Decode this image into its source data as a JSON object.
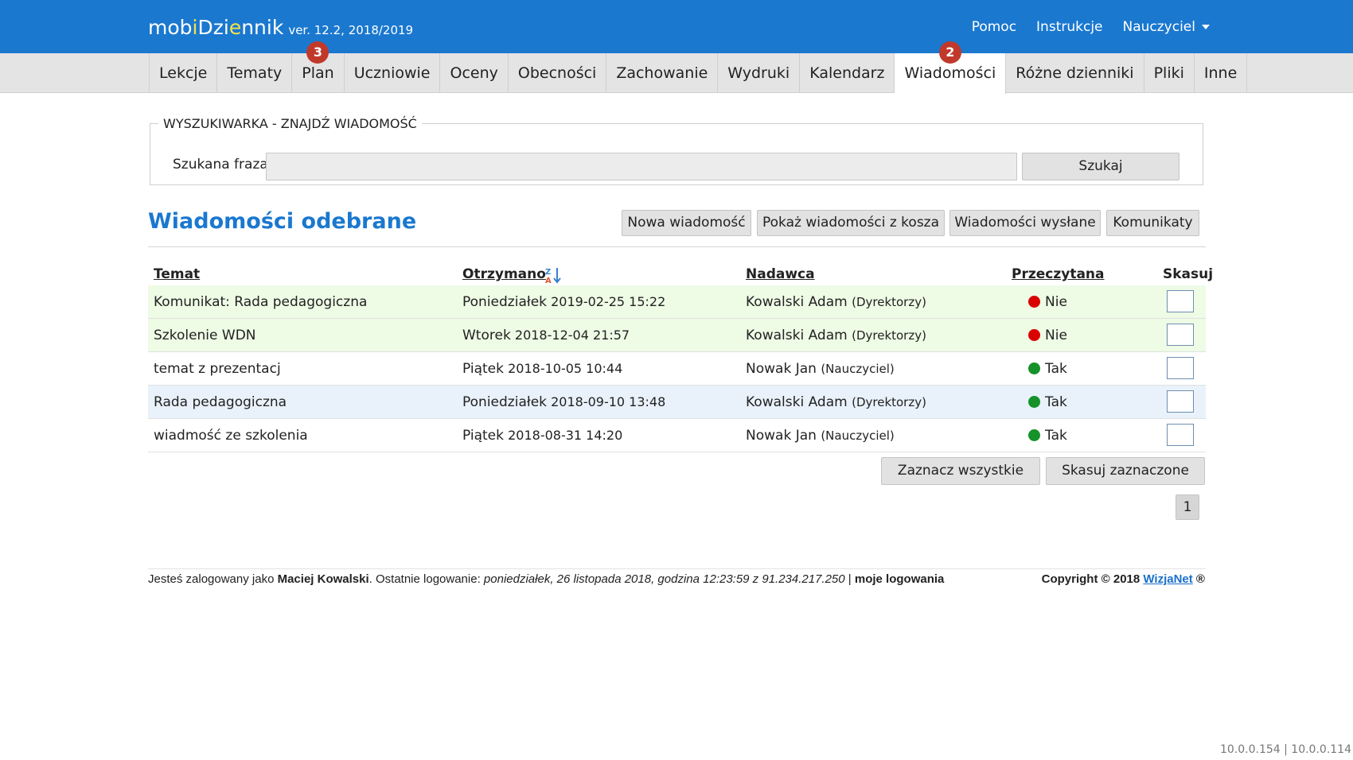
{
  "header": {
    "brand_part1": "mob",
    "brand_part2": "i",
    "brand_part3": "Dzi",
    "brand_part4": "e",
    "brand_part5": "nnik",
    "version": "ver. 12.2, 2018/2019",
    "links": [
      "Pomoc",
      "Instrukcje",
      "Nauczyciel"
    ]
  },
  "nav": {
    "tabs": [
      {
        "label": "Lekcje"
      },
      {
        "label": "Tematy"
      },
      {
        "label": "Plan",
        "badge": "3"
      },
      {
        "label": "Uczniowie"
      },
      {
        "label": "Oceny"
      },
      {
        "label": "Obecności"
      },
      {
        "label": "Zachowanie"
      },
      {
        "label": "Wydruki"
      },
      {
        "label": "Kalendarz"
      },
      {
        "label": "Wiadomości",
        "badge": "2",
        "active": true
      },
      {
        "label": "Różne dzienniki"
      },
      {
        "label": "Pliki"
      },
      {
        "label": "Inne"
      }
    ]
  },
  "search": {
    "legend": "WYSZUKIWARKA - ZNAJDŹ WIADOMOŚĆ",
    "label": "Szukana fraza",
    "value": "",
    "button": "Szukaj"
  },
  "main": {
    "title": "Wiadomości odebrane",
    "actions": {
      "new": "Nowa wiadomość",
      "trash": "Pokaż wiadomości z kosza",
      "sent": "Wiadomości wysłane",
      "notices": "Komunikaty"
    },
    "columns": {
      "subject": "Temat",
      "received": "Otrzymano",
      "sender": "Nadawca",
      "read": "Przeczytana",
      "delete": "Skasuj"
    },
    "messages": [
      {
        "subject": "Komunikat: Rada pedagogiczna",
        "day": "Poniedziałek",
        "datetime": "2019-02-25 15:22",
        "sender": "Kowalski Adam",
        "group": "(Dyrektorzy)",
        "read": "Nie"
      },
      {
        "subject": "Szkolenie WDN",
        "day": "Wtorek",
        "datetime": "2018-12-04 21:57",
        "sender": "Kowalski Adam",
        "group": "(Dyrektorzy)",
        "read": "Nie"
      },
      {
        "subject": "temat z prezentacj",
        "day": "Piątek",
        "datetime": "2018-10-05 10:44",
        "sender": "Nowak Jan",
        "group": "(Nauczyciel)",
        "read": "Tak"
      },
      {
        "subject": "Rada pedagogiczna",
        "day": "Poniedziałek",
        "datetime": "2018-09-10 13:48",
        "sender": "Kowalski Adam",
        "group": "(Dyrektorzy)",
        "read": "Tak"
      },
      {
        "subject": "wiadmość ze szkolenia",
        "day": "Piątek",
        "datetime": "2018-08-31 14:20",
        "sender": "Nowak Jan",
        "group": "(Nauczyciel)",
        "read": "Tak"
      }
    ],
    "select_all": "Zaznacz wszystkie",
    "delete_selected": "Skasuj zaznaczone",
    "page": "1"
  },
  "footer": {
    "prefix": "Jesteś zalogowany jako ",
    "user": "Maciej Kowalski",
    "last_login_label": ". Ostatnie logowanie: ",
    "last_login": "poniedziałek, 26 listopada 2018, godzina 12:23:59 z 91.234.217.250",
    "divider": " | ",
    "my_logins": "moje logowania",
    "copyright": "Copyright © 2018 ",
    "company": "WizjaNet",
    "reg": " ®",
    "ip": "10.0.0.154 | 10.0.0.114"
  },
  "colors": {
    "brand": "#1a78cf",
    "unread_dot": "#d90000",
    "read_dot": "#15922a",
    "badge": "#c0392b"
  }
}
